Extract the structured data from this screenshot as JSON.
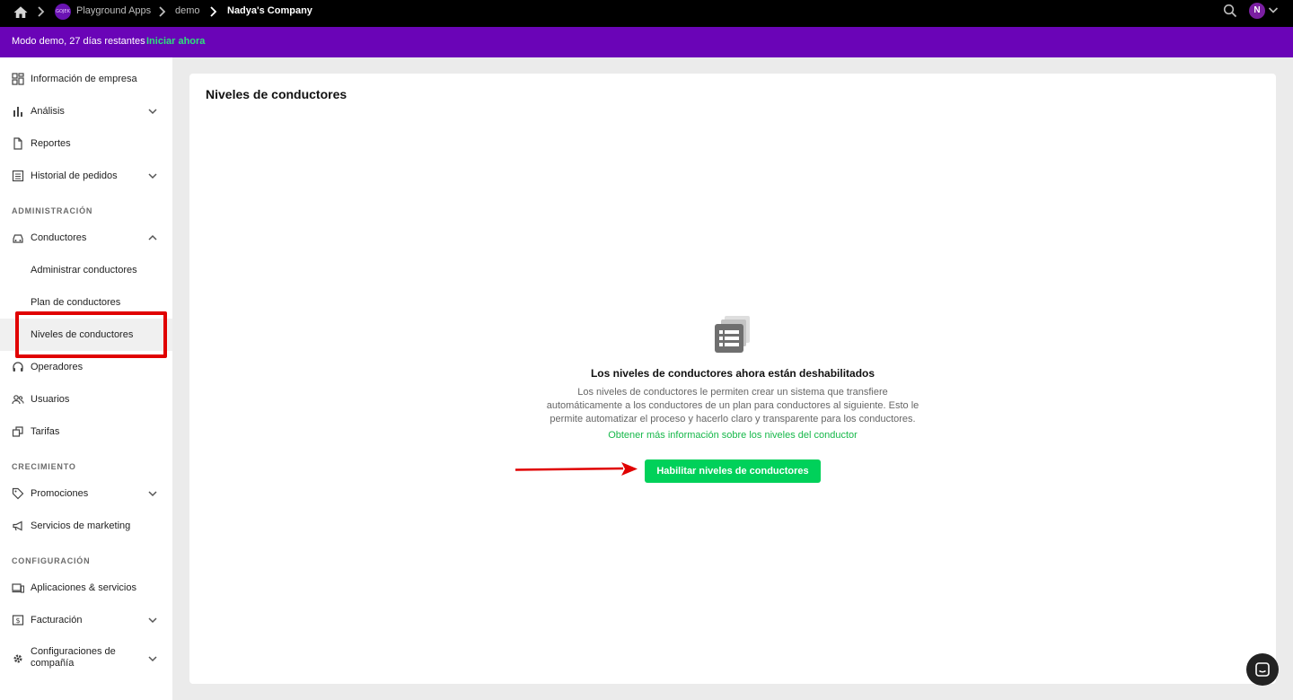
{
  "topbar": {
    "breadcrumbs": [
      {
        "label": "Playground Apps"
      },
      {
        "label": "demo"
      },
      {
        "label": "Nadya's Company"
      }
    ],
    "logo_text": "GOJEK",
    "avatar_initial": "N"
  },
  "banner": {
    "text": "Modo demo, 27 días restantes",
    "link": "Iniciar ahora"
  },
  "sidebar": {
    "items": [
      {
        "label": "Información de empresa"
      },
      {
        "label": "Análisis"
      },
      {
        "label": "Reportes"
      },
      {
        "label": "Historial de pedidos"
      }
    ],
    "sections": {
      "admin": "ADMINISTRACIÓN",
      "growth": "CRECIMIENTO",
      "config": "CONFIGURACIÓN"
    },
    "admin_items": [
      {
        "label": "Conductores"
      },
      {
        "label": "Administrar conductores"
      },
      {
        "label": "Plan de conductores"
      },
      {
        "label": "Niveles de conductores"
      },
      {
        "label": "Operadores"
      },
      {
        "label": "Usuarios"
      },
      {
        "label": "Tarifas"
      }
    ],
    "growth_items": [
      {
        "label": "Promociones"
      },
      {
        "label": "Servicios de marketing"
      }
    ],
    "config_items": [
      {
        "label": "Aplicaciones & servicios"
      },
      {
        "label": "Facturación"
      },
      {
        "label": "Configuraciones de compañía"
      }
    ]
  },
  "main": {
    "title": "Niveles de conductores",
    "empty_title": "Los niveles de conductores ahora están deshabilitados",
    "empty_description": "Los niveles de conductores le permiten crear un sistema que transfiere automáticamente a los conductores de un plan para conductores al siguiente. Esto le permite automatizar el proceso y hacerlo claro y transparente para los conductores.",
    "learn_more": "Obtener más información sobre los niveles del conductor",
    "enable_button": "Habilitar niveles de conductores"
  },
  "colors": {
    "banner": "#6a04b7",
    "accent_green": "#00d15a",
    "highlight_red": "#e00000"
  }
}
